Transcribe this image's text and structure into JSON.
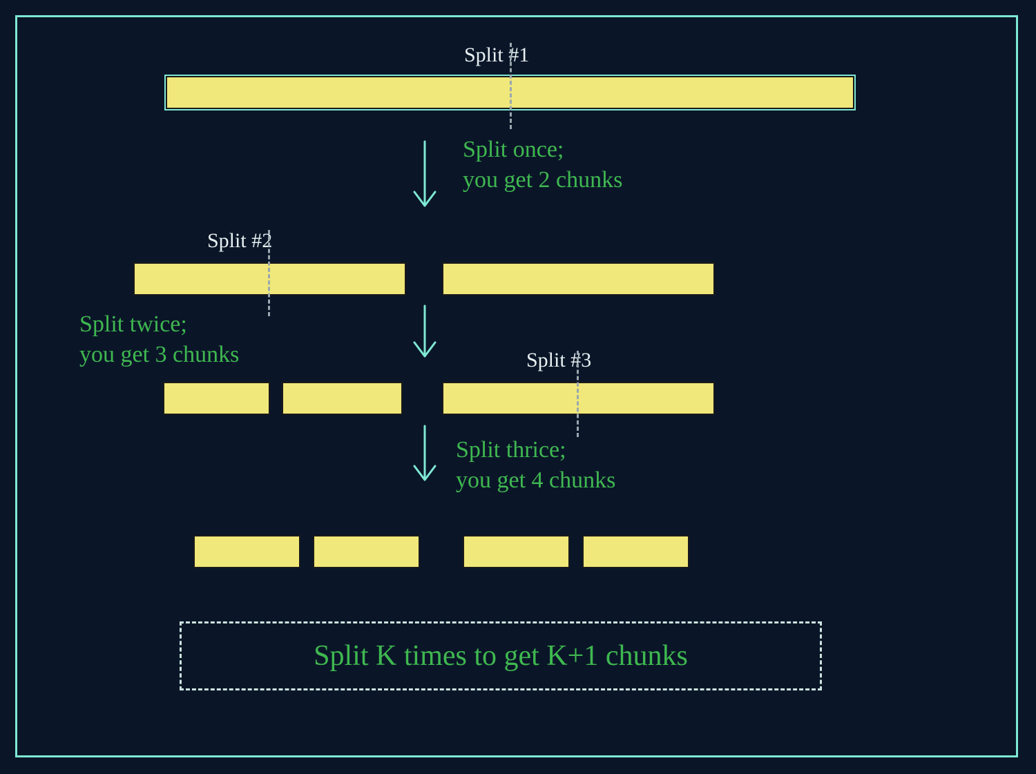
{
  "labels": {
    "split1": "Split #1",
    "split2": "Split #2",
    "split3": "Split #3"
  },
  "captions": {
    "once": "Split once;\nyou get 2 chunks",
    "twice": "Split twice;\nyou get 3 chunks",
    "thrice": "Split thrice;\nyou get 4 chunks"
  },
  "formula": "Split K times to get K+1 chunks",
  "colors": {
    "bg": "#0a1628",
    "frame": "#7fe8d4",
    "bar": "#f0e87a",
    "text_white": "#e8f0f2",
    "text_green": "#3fb850",
    "dash": "#9aa8af"
  }
}
